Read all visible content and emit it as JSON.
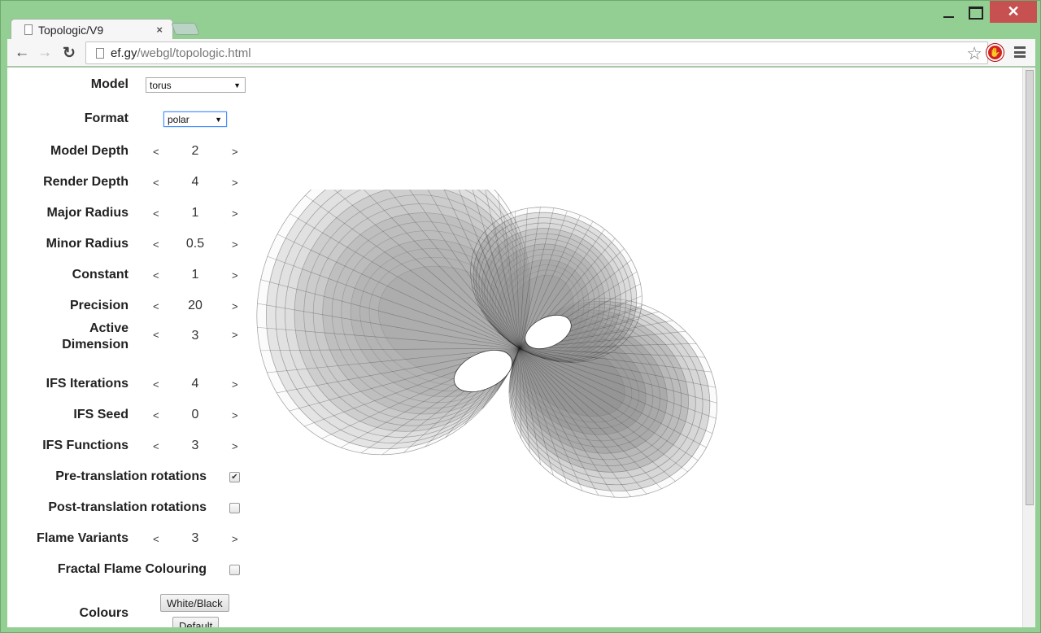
{
  "browser": {
    "tab_title": "Topologic/V9",
    "tab_close": "×",
    "window_close": "✕",
    "url_host": "ef.gy",
    "url_path": "/webgl/topologic.html",
    "star": "☆",
    "back": "←",
    "forward": "→",
    "reload": "↻",
    "extension": "✋"
  },
  "controls": {
    "model": {
      "label": "Model",
      "value": "torus"
    },
    "format": {
      "label": "Format",
      "value": "polar"
    },
    "steppers": [
      {
        "label": "Model Depth",
        "value": "2"
      },
      {
        "label": "Render Depth",
        "value": "4"
      },
      {
        "label": "Major Radius",
        "value": "1"
      },
      {
        "label": "Minor Radius",
        "value": "0.5"
      },
      {
        "label": "Constant",
        "value": "1"
      },
      {
        "label": "Precision",
        "value": "20"
      },
      {
        "label": "Active Dimension",
        "value": "3"
      },
      {
        "label": "IFS Iterations",
        "value": "4"
      },
      {
        "label": "IFS Seed",
        "value": "0"
      },
      {
        "label": "IFS Functions",
        "value": "3"
      }
    ],
    "pre_translation": {
      "label": "Pre-translation rotations",
      "checked": true,
      "mark": "✔"
    },
    "post_translation": {
      "label": "Post-translation rotations",
      "checked": false
    },
    "flame_variants": {
      "label": "Flame Variants",
      "value": "3"
    },
    "fractal_flame_colouring": {
      "label": "Fractal Flame Colouring",
      "checked": false
    },
    "colours": {
      "label": "Colours",
      "buttons": [
        "White/Black",
        "Default"
      ]
    },
    "decrement": "<",
    "increment": ">"
  },
  "render": {
    "description": "polar torus wireframe render"
  }
}
